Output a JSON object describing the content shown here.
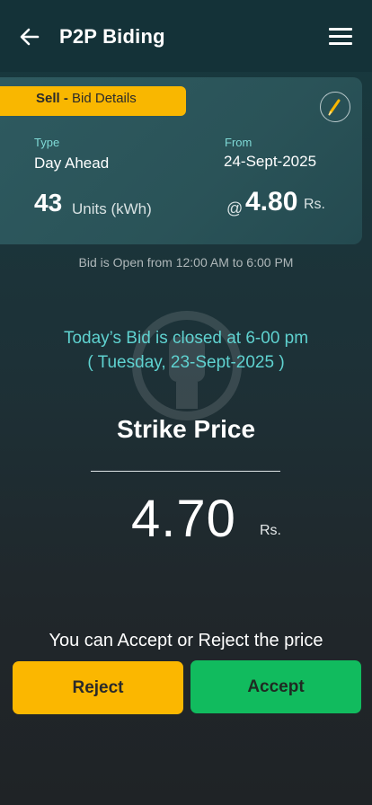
{
  "header": {
    "title": "P2P Biding",
    "back_icon": "arrow-left-icon",
    "menu_icon": "hamburger-menu-icon"
  },
  "bid_card": {
    "badge_action": "Sell -",
    "badge_text": " Bid Details",
    "edit_icon": "pencil-icon",
    "type_label": "Type",
    "type_value": "Day Ahead",
    "from_label": "From",
    "from_value": "24-Sept-2025",
    "units_value": "43",
    "units_label": "Units (kWh)",
    "at_symbol": "@",
    "price_value": "4.80",
    "price_currency": "Rs."
  },
  "open_info": "Bid is Open from  12:00 AM to 6:00 PM",
  "closed_notice": {
    "line1": "Today’s Bid is closed at 6-00 pm",
    "line2": "( Tuesday, 23-Sept-2025 )"
  },
  "strike": {
    "label": "Strike Price",
    "value": "4.70",
    "currency": "Rs."
  },
  "action": {
    "prompt": "You can Accept or Reject the price",
    "reject_label": "Reject",
    "accept_label": "Accept"
  },
  "colors": {
    "accent_yellow": "#f9b700",
    "accent_green": "#11bb5e",
    "teal_text": "#5fd2d0"
  }
}
